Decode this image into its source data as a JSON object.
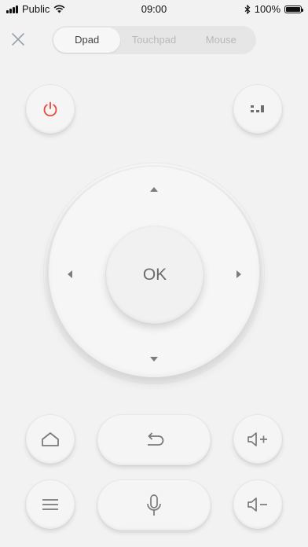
{
  "status_bar": {
    "carrier": "Public",
    "time": "09:00",
    "battery": "100%",
    "battery_level": 1.0
  },
  "header": {
    "tabs": [
      {
        "label": "Dpad",
        "active": true
      },
      {
        "label": "Touchpad",
        "active": false
      },
      {
        "label": "Mouse",
        "active": false
      }
    ]
  },
  "dpad": {
    "ok_label": "OK"
  },
  "icons": {
    "close": "close-icon",
    "power": "power-icon",
    "menu_grid": "app-menu-icon",
    "home": "home-icon",
    "back": "back-icon",
    "volume_up": "volume-up-icon",
    "menu": "menu-icon",
    "mic": "microphone-icon",
    "volume_down": "volume-down-icon"
  },
  "colors": {
    "background": "#f2f2f2",
    "power_accent": "#e8453c",
    "icon_gray": "#7a7a7a",
    "tab_active_text": "#444444",
    "tab_inactive_text": "#b9b9b9"
  }
}
